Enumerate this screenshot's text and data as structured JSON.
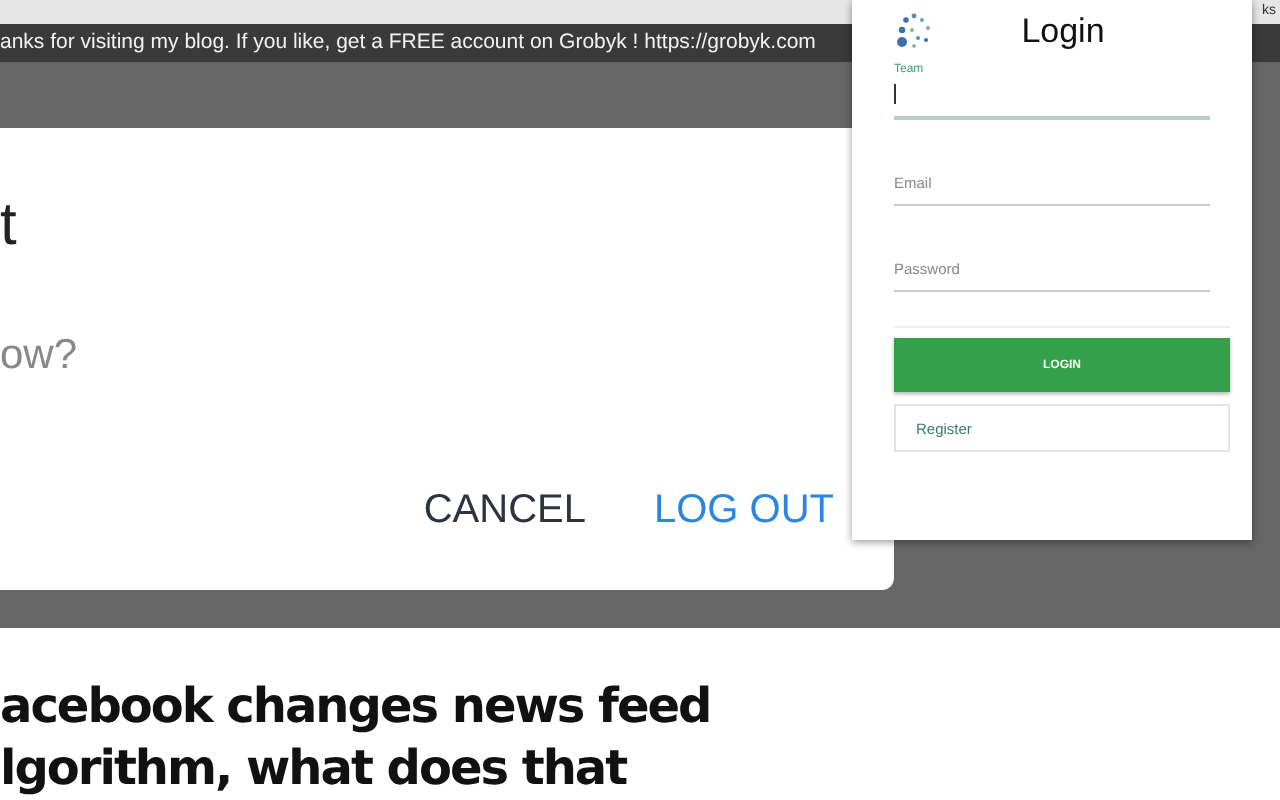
{
  "browser": {
    "corner_text": "ks"
  },
  "banner": {
    "text": "anks for visiting my blog. If you like, get a FREE account on Grobyk ! https://grobyk.com"
  },
  "dialog": {
    "title": "t",
    "message": "ow?",
    "buttons": [
      {
        "label": "CANCEL",
        "kind": "plain"
      },
      {
        "label": "LOG OUT",
        "kind": "primary"
      }
    ]
  },
  "article": {
    "headline": [
      "acebook changes news feed",
      "lgorithm, what does that"
    ]
  },
  "login_popup": {
    "title": "Login",
    "fields": [
      {
        "placeholder": "Team",
        "focused": true
      },
      {
        "placeholder": "Email",
        "focused": false
      },
      {
        "placeholder": "Password",
        "focused": false
      }
    ],
    "submit": "LOGIN",
    "register": "Register"
  }
}
